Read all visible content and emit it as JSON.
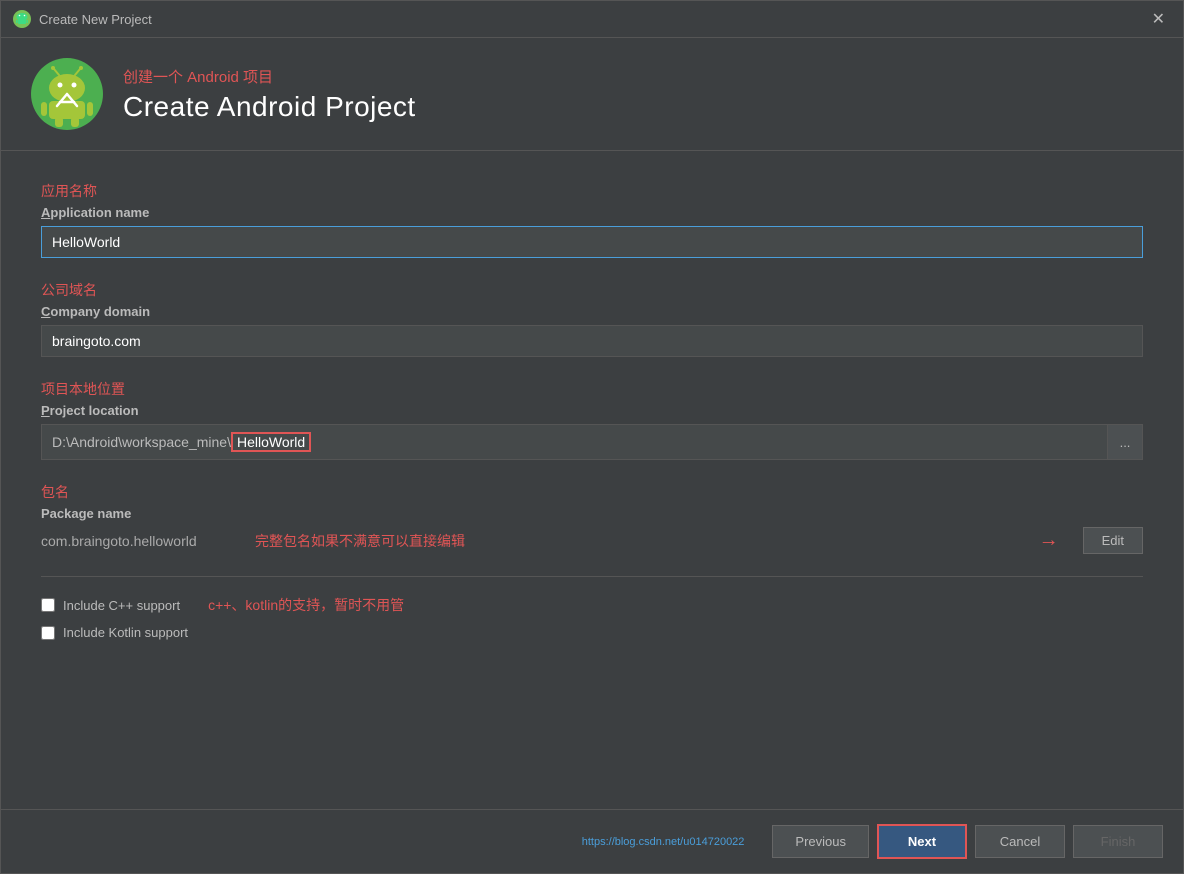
{
  "window": {
    "title": "Create New Project",
    "close_label": "✕"
  },
  "header": {
    "subtitle_cn": "创建一个 Android 项目",
    "title": "Create Android Project"
  },
  "form": {
    "app_name_label_cn": "应用名称",
    "app_name_label_en": "Application name",
    "app_name_value": "HelloWorld",
    "company_domain_label_cn": "公司域名",
    "company_domain_label_en": "Company domain",
    "company_domain_value": "braingoto.com",
    "project_location_label_cn": "项目本地位置",
    "project_location_label_en": "Project location",
    "project_location_value": "D:\\Android\\workspace_mine\\HelloWorld",
    "project_location_prefix": "D:\\Android\\workspace_mine\\",
    "project_location_highlighted": "HelloWorld",
    "browse_btn_label": "...",
    "package_label_cn": "包名",
    "package_label_en": "Package name",
    "package_name_value": "com.braingoto.helloworld",
    "package_annotation": "完整包名如果不满意可以直接编辑",
    "edit_btn_label": "Edit",
    "cpp_support_label": "Include C++ support",
    "kotlin_support_label": "Include Kotlin support",
    "checkbox_annotation": "c++、kotlin的支持，暂时不用管"
  },
  "footer": {
    "url": "https://blog.csdn.net/u014720022",
    "previous_label": "Previous",
    "next_label": "Next",
    "cancel_label": "Cancel",
    "finish_label": "Finish"
  }
}
